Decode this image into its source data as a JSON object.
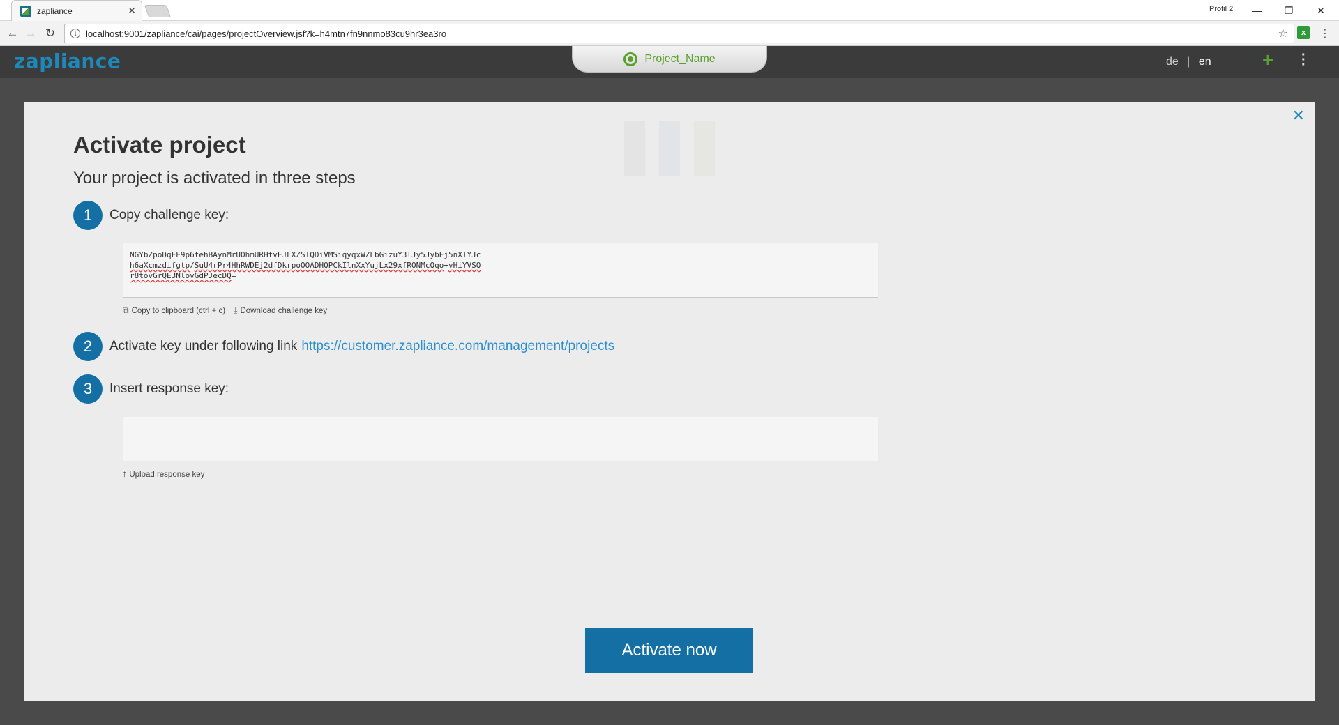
{
  "browser": {
    "tab_title": "zapliance",
    "tab_close": "✕",
    "profile": "Profil 2",
    "url": "localhost:9001/zapliance/cai/pages/projectOverview.jsf?k=h4mtn7fn9nnmo83cu9hr3ea3ro"
  },
  "header": {
    "logo": "zapliance",
    "project_name": "Project_Name",
    "lang_de": "de",
    "lang_sep": "|",
    "lang_en": "en"
  },
  "modal": {
    "title": "Activate project",
    "subtitle": "Your project is activated in three steps",
    "step1": {
      "num": "1",
      "text": "Copy challenge key:"
    },
    "challenge_key": {
      "line1": "NGYbZpoDqFE9p6tehBAynMrUOhmURHtvEJLXZSTQDiVMSiqyqxWZLbGizuY3lJy5JybEj5nXIYJc",
      "line2a": "h6aXcmzdifgtp",
      "line2b": "/",
      "line2c": "SuU4rPr4HhRWDEj2dfDkrpoOOADHQPCkIlnXxYujLx29xfRONMcQqo",
      "line2d": "+",
      "line2e": "vHiYVSQ",
      "line3a": "r8tovGrQE3NlovGdPJecDQ",
      "line3b": "="
    },
    "copy_label": "Copy to clipboard (ctrl + c)",
    "download_label": "Download challenge key",
    "step2": {
      "num": "2",
      "text": "Activate key under following link",
      "link": "https://customer.zapliance.com/management/projects"
    },
    "step3": {
      "num": "3",
      "text": "Insert response key:"
    },
    "upload_label": "Upload response key",
    "activate_button": "Activate now"
  },
  "colors": {
    "accent_blue": "#1470a4",
    "logo_blue": "#1f88b8",
    "brand_green": "#5aa02c",
    "header_bg": "#3b3b3b",
    "modal_bg": "#ececec"
  }
}
